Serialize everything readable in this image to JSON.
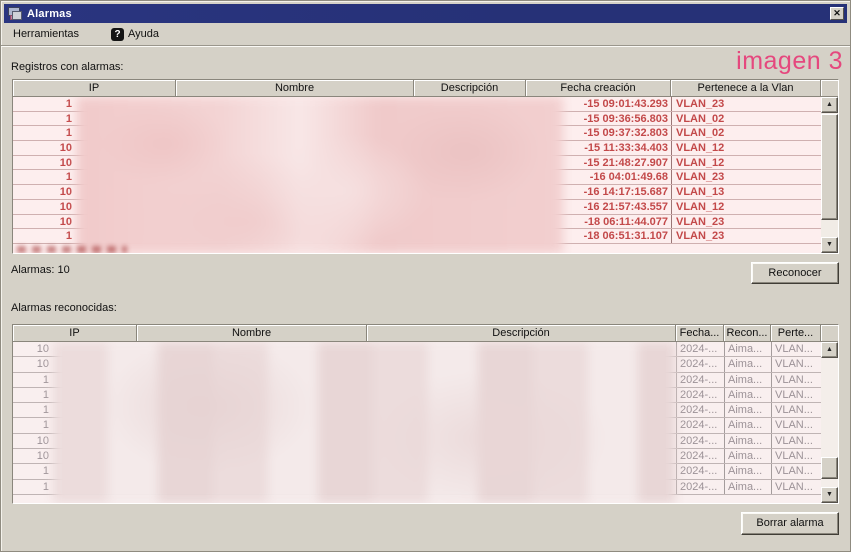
{
  "window": {
    "title": "Alarmas",
    "close_label": "✕"
  },
  "menu": {
    "items": [
      {
        "label": "Herramientas"
      },
      {
        "label": "Ayuda",
        "icon_glyph": "?"
      }
    ]
  },
  "watermark": "imagen 3",
  "alarms_section": {
    "label": "Registros con alarmas:",
    "columns": [
      "IP",
      "Nombre",
      "Descripción",
      "Fecha creación",
      "Pertenece a la Vlan"
    ],
    "rows": [
      {
        "ip": "1",
        "fecha": "-15 09:01:43.293",
        "vlan": "VLAN_23"
      },
      {
        "ip": "1",
        "fecha": "-15 09:36:56.803",
        "vlan": "VLAN_02"
      },
      {
        "ip": "1",
        "fecha": "-15 09:37:32.803",
        "vlan": "VLAN_02"
      },
      {
        "ip": "10",
        "fecha": "-15 11:33:34.403",
        "vlan": "VLAN_12"
      },
      {
        "ip": "10",
        "fecha": "-15 21:48:27.907",
        "vlan": "VLAN_12"
      },
      {
        "ip": "1",
        "fecha": "-16 04:01:49.68",
        "vlan": "VLAN_23"
      },
      {
        "ip": "10",
        "fecha": "-16 14:17:15.687",
        "vlan": "VLAN_13"
      },
      {
        "ip": "10",
        "fecha": "-16 21:57:43.557",
        "vlan": "VLAN_12"
      },
      {
        "ip": "10",
        "fecha": "-18 06:11:44.077",
        "vlan": "VLAN_23"
      },
      {
        "ip": "1",
        "fecha": "-18 06:51:31.107",
        "vlan": "VLAN_23"
      }
    ],
    "count_label": "Alarmas: 10",
    "acknowledge_button": "Reconocer"
  },
  "acknowledged_section": {
    "label": "Alarmas reconocidas:",
    "columns": [
      "IP",
      "Nombre",
      "Descripción",
      "Fecha...",
      "Recon...",
      "Perte..."
    ],
    "rows": [
      {
        "ip": "10",
        "fecha": "2024-...",
        "recon": "Aima...",
        "perte": "VLAN..."
      },
      {
        "ip": "10",
        "fecha": "2024-...",
        "recon": "Aima...",
        "perte": "VLAN..."
      },
      {
        "ip": "1",
        "fecha": "2024-...",
        "recon": "Aima...",
        "perte": "VLAN..."
      },
      {
        "ip": "1",
        "fecha": "2024-...",
        "recon": "Aima...",
        "perte": "VLAN..."
      },
      {
        "ip": "1",
        "fecha": "2024-...",
        "recon": "Aima...",
        "perte": "VLAN..."
      },
      {
        "ip": "1",
        "fecha": "2024-...",
        "recon": "Aima...",
        "perte": "VLAN..."
      },
      {
        "ip": "10",
        "fecha": "2024-...",
        "recon": "Aima...",
        "perte": "VLAN..."
      },
      {
        "ip": "10",
        "fecha": "2024-...",
        "recon": "Aima...",
        "perte": "VLAN..."
      },
      {
        "ip": "1",
        "fecha": "2024-...",
        "recon": "Aima...",
        "perte": "VLAN..."
      },
      {
        "ip": "1",
        "fecha": "2024-...",
        "recon": "Aima...",
        "perte": "VLAN..."
      }
    ],
    "delete_button": "Borrar alarma"
  },
  "colors": {
    "titlebar_blue": "#263177",
    "alarm_red": "#c3494a",
    "watermark_pink": "#e5487e",
    "window_bg": "#d5d1c7"
  }
}
